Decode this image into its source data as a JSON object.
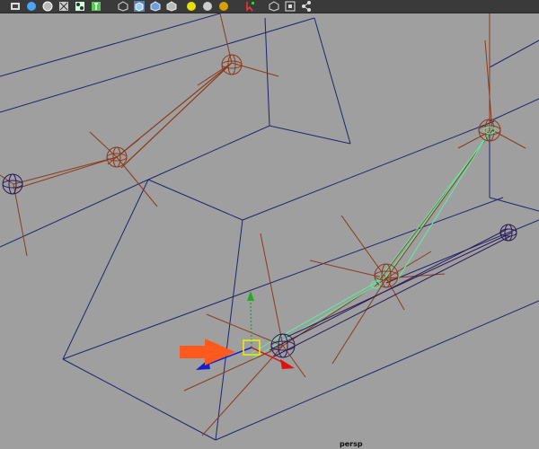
{
  "viewport": {
    "camera_label": "persp",
    "background_color": "#a0a0a0"
  },
  "toolbar": {
    "background_color": "#3a3a3a",
    "buttons": [
      {
        "name": "film-gate-icon"
      },
      {
        "name": "smooth-shade-icon"
      },
      {
        "name": "wireframe-on-shaded-icon"
      },
      {
        "name": "xray-icon"
      },
      {
        "name": "xray-joints-icon"
      },
      {
        "name": "textured-icon"
      },
      {
        "name": "default-material-icon"
      },
      {
        "name": "shaded-cube-icon"
      },
      {
        "name": "flat-cube-icon"
      },
      {
        "name": "lit-cube-icon"
      },
      {
        "name": "light-sphere-yellow-icon"
      },
      {
        "name": "light-sphere-grey-icon"
      },
      {
        "name": "light-sphere-gold-icon"
      },
      {
        "name": "camera-select-icon"
      },
      {
        "name": "isolate-select-icon"
      },
      {
        "name": "frame-all-icon"
      },
      {
        "name": "share-icon"
      }
    ]
  },
  "colors": {
    "wireframe": "#1e2470",
    "rig_lines": "#8b3a1a",
    "selection": "#5cf0a0",
    "manip_x": "#e01010",
    "manip_y": "#22aa22",
    "manip_z": "#1020d0",
    "annotation_arrow": "#ff5a1e",
    "selected_handle": "#f0f000"
  }
}
